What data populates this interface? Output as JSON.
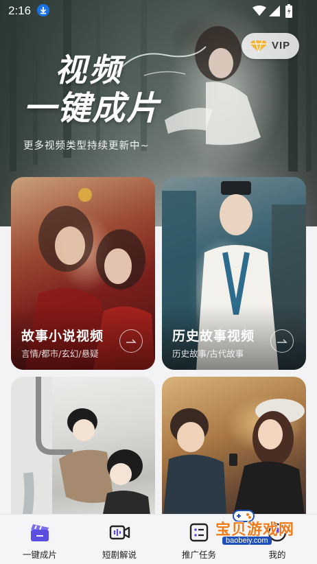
{
  "status_bar": {
    "time": "2:16"
  },
  "hero": {
    "title_line1": "视频",
    "title_line2": "一键成片",
    "subtitle": "更多视频类型持续更新中~",
    "vip_label": "VIP"
  },
  "cards": [
    {
      "title": "故事小说视频",
      "tags": "言情/都市/玄幻/悬疑"
    },
    {
      "title": "历史故事视频",
      "tags": "历史故事/古代故事"
    }
  ],
  "bottom_nav": {
    "items": [
      {
        "label": "一键成片",
        "icon": "clapperboard-icon",
        "active": true
      },
      {
        "label": "短剧解说",
        "icon": "video-camera-icon",
        "active": false
      },
      {
        "label": "推广任务",
        "icon": "task-list-icon",
        "active": false
      },
      {
        "label": "我的",
        "icon": "profile-icon",
        "active": false
      }
    ]
  },
  "watermark": {
    "text": "宝贝游戏网",
    "url": "baobeiy.com"
  },
  "colors": {
    "accent": "#5b4de0",
    "vip_gem": "#f4b43a",
    "watermark": "#f07b1c"
  }
}
